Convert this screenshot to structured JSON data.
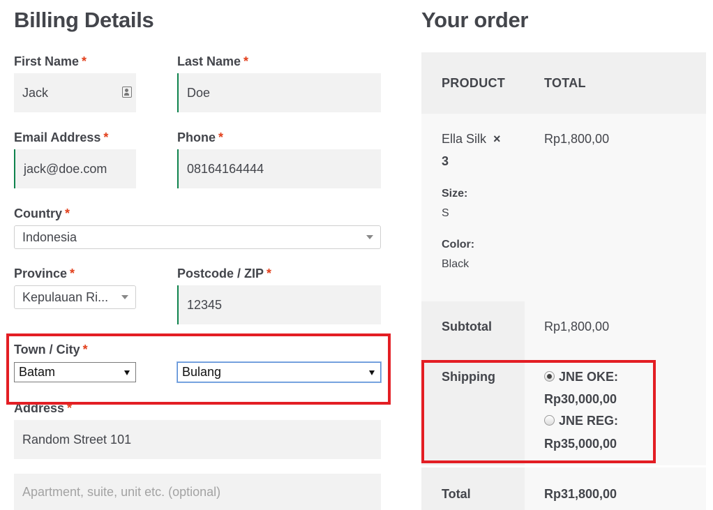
{
  "billing": {
    "title": "Billing Details",
    "required_mark": "*",
    "first_name": {
      "label": "First Name",
      "value": "Jack"
    },
    "last_name": {
      "label": "Last Name",
      "value": "Doe"
    },
    "email": {
      "label": "Email Address",
      "value": "jack@doe.com"
    },
    "phone": {
      "label": "Phone",
      "value": "08164164444"
    },
    "country": {
      "label": "Country",
      "value": "Indonesia"
    },
    "province": {
      "label": "Province",
      "value": "Kepulauan Ri..."
    },
    "postcode": {
      "label": "Postcode / ZIP",
      "value": "12345"
    },
    "town_city": {
      "label": "Town / City",
      "city_value": "Batam",
      "district_value": "Bulang"
    },
    "address": {
      "label": "Address",
      "value": "Random Street 101",
      "line2_placeholder": "Apartment, suite, unit etc. (optional)"
    }
  },
  "order": {
    "title": "Your order",
    "col_product": "PRODUCT",
    "col_total": "TOTAL",
    "item": {
      "name": "Ella Silk",
      "times": "×",
      "qty": "3",
      "total": "Rp1,800,00",
      "size_label": "Size:",
      "size_value": "S",
      "color_label": "Color:",
      "color_value": "Black"
    },
    "subtotal": {
      "label": "Subtotal",
      "value": "Rp1,800,00"
    },
    "shipping": {
      "label": "Shipping",
      "options": [
        {
          "name": "JNE OKE:",
          "price": "Rp30,000,00",
          "selected": true
        },
        {
          "name": "JNE REG:",
          "price": "Rp35,000,00",
          "selected": false
        }
      ]
    },
    "total": {
      "label": "Total",
      "value": "Rp31,800,00"
    }
  },
  "colors": {
    "required": "#e2401c",
    "valid_border": "#0f834d",
    "highlight": "#e31e24",
    "field_bg": "#f2f2f2",
    "table_bg": "#f8f8f8"
  }
}
